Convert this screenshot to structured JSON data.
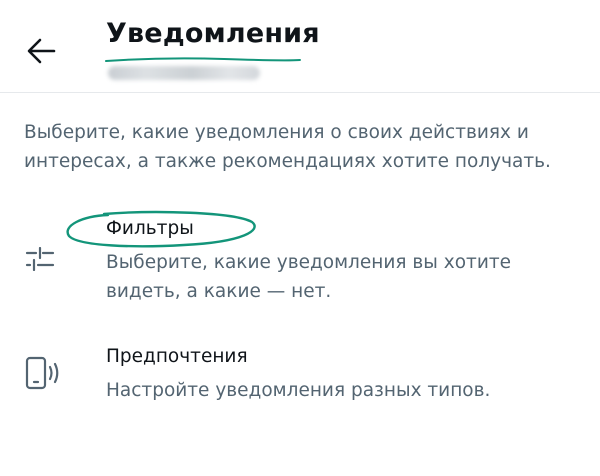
{
  "header": {
    "title": "Уведомления",
    "back_icon": "arrow-left-icon",
    "accent_color": "#13957a"
  },
  "description": "Выберите, какие уведомления о своих действиях и интересах, а также рекомендациях хотите получать.",
  "settings": [
    {
      "title": "Фильтры",
      "description": "Выберите, какие уведомления вы хотите видеть, а какие — нет.",
      "icon": "sliders-icon"
    },
    {
      "title": "Предпочтения",
      "description": "Настройте уведомления разных типов.",
      "icon": "phone-vibrate-icon"
    }
  ],
  "colors": {
    "text_primary": "#0f1419",
    "text_secondary": "#536471",
    "highlight": "#13957a"
  }
}
